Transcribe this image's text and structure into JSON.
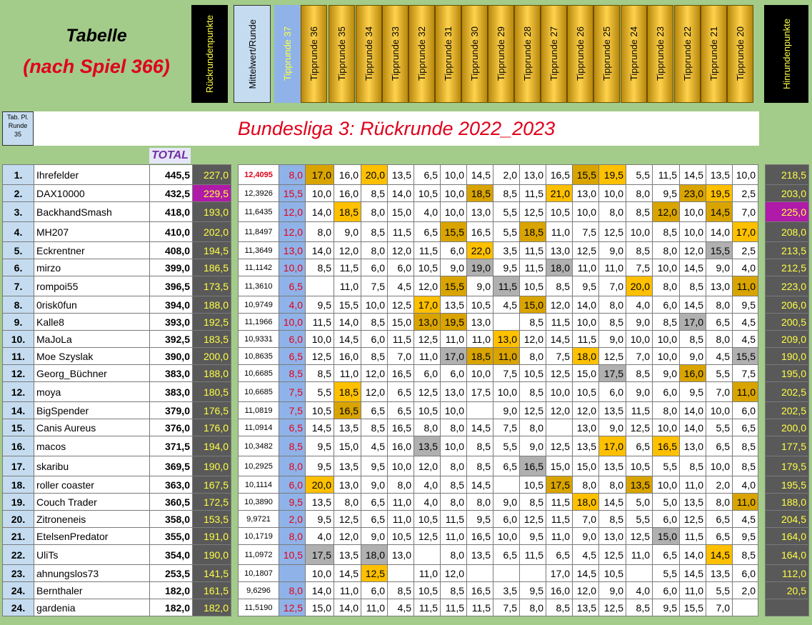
{
  "title_line1": "Tabelle",
  "title_line2": "(nach Spiel 366)",
  "headers": {
    "rueckrunde": "Rückrundenpunkte",
    "mittelwert": "Mittelwert/Runde",
    "tipp37": "Tipprunde 37",
    "tipprunden": [
      "Tipprunde 36",
      "Tipprunde 35",
      "Tipprunde 34",
      "Tipprunde 33",
      "Tipprunde 32",
      "Tipprunde 31",
      "Tipprunde 30",
      "Tipprunde 29",
      "Tipprunde 28",
      "Tipprunde 27",
      "Tipprunde 26",
      "Tipprunde 25",
      "Tipprunde 24",
      "Tipprunde 23",
      "Tipprunde 22",
      "Tipprunde 21",
      "Tipprunde 20"
    ],
    "hinrunde": "Hinrundenpunkte"
  },
  "tab_pl": [
    "Tab. Pl.",
    "Runde",
    "35"
  ],
  "banner": "Bundesliga 3: Rückrunde 2022_2023",
  "total_label": "TOTAL",
  "colors": {
    "background": "#a3cb8a",
    "gold": "#d9a400",
    "orange": "#ffc000",
    "silver": "#b0b0b0",
    "dark": "#595959",
    "yellow_text": "#ffff44",
    "red": "#e0001b",
    "magenta": "#b01aa8"
  },
  "rows": [
    {
      "pl": "1.",
      "name": "Ihrefelder",
      "total": "445,5",
      "rr": "227,0",
      "mw": "12,4095",
      "t37": "8,0",
      "t": [
        "17,0",
        "16,0",
        "20,0",
        "13,5",
        "6,5",
        "10,0",
        "14,5",
        "2,0",
        "13,0",
        "16,5",
        "15,5",
        "19,5",
        "5,5",
        "11,5",
        "14,5",
        "13,5",
        "10,0"
      ],
      "hr": "218,5",
      "mw_red": true
    },
    {
      "pl": "2.",
      "name": "DAX10000",
      "total": "432,5",
      "rr": "229,5",
      "mw": "12,3926",
      "t37": "15,5",
      "t": [
        "10,0",
        "16,0",
        "8,5",
        "14,0",
        "10,5",
        "10,0",
        "18,5",
        "8,5",
        "11,5",
        "21,0",
        "13,0",
        "10,0",
        "8,0",
        "9,5",
        "23,0",
        "19,5",
        "2,5"
      ],
      "hr": "203,0"
    },
    {
      "pl": "3.",
      "name": "BackhandSmash",
      "total": "418,0",
      "rr": "193,0",
      "mw": "11,6435",
      "t37": "12,0",
      "t": [
        "14,0",
        "18,5",
        "8,0",
        "15,0",
        "4,0",
        "10,0",
        "13,0",
        "5,5",
        "12,5",
        "10,5",
        "10,0",
        "8,0",
        "8,5",
        "12,0",
        "10,0",
        "14,5",
        "7,0"
      ],
      "hr": "225,0"
    },
    {
      "pl": "4.",
      "name": "MH207",
      "total": "410,0",
      "rr": "202,0",
      "mw": "11,8497",
      "t37": "12,0",
      "t": [
        "8,0",
        "9,0",
        "8,5",
        "11,5",
        "6,5",
        "15,5",
        "16,5",
        "5,5",
        "18,5",
        "11,0",
        "7,5",
        "12,5",
        "10,0",
        "8,5",
        "10,0",
        "14,0",
        "17,0"
      ],
      "hr": "208,0"
    },
    {
      "pl": "5.",
      "name": "Eckrentner",
      "total": "408,0",
      "rr": "194,5",
      "mw": "11,3649",
      "t37": "13,0",
      "t": [
        "14,0",
        "12,0",
        "8,0",
        "12,0",
        "11,5",
        "6,0",
        "22,0",
        "3,5",
        "11,5",
        "13,0",
        "12,5",
        "9,0",
        "8,5",
        "8,0",
        "12,0",
        "15,5",
        "2,5"
      ],
      "hr": "213,5"
    },
    {
      "pl": "6.",
      "name": "mirzo",
      "total": "399,0",
      "rr": "186,5",
      "mw": "11,1142",
      "t37": "10,0",
      "t": [
        "8,5",
        "11,5",
        "6,0",
        "6,0",
        "10,5",
        "9,0",
        "19,0",
        "9,5",
        "11,5",
        "18,0",
        "11,0",
        "11,0",
        "7,5",
        "10,0",
        "14,5",
        "9,0",
        "4,0"
      ],
      "hr": "212,5"
    },
    {
      "pl": "7.",
      "name": "rompoi55",
      "total": "396,5",
      "rr": "173,5",
      "mw": "11,3610",
      "t37": "6,5",
      "t": [
        "",
        "11,0",
        "7,5",
        "4,5",
        "12,0",
        "15,5",
        "9,0",
        "11,5",
        "10,5",
        "8,5",
        "9,5",
        "7,0",
        "20,0",
        "8,0",
        "8,5",
        "13,0",
        "11,0"
      ],
      "hr": "223,0"
    },
    {
      "pl": "8.",
      "name": "0risk0fun",
      "total": "394,0",
      "rr": "188,0",
      "mw": "10,9749",
      "t37": "4,0",
      "t": [
        "9,5",
        "15,5",
        "10,0",
        "12,5",
        "17,0",
        "13,5",
        "10,5",
        "4,5",
        "15,0",
        "12,0",
        "14,0",
        "8,0",
        "4,0",
        "6,0",
        "14,5",
        "8,0",
        "9,5"
      ],
      "hr": "206,0"
    },
    {
      "pl": "9.",
      "name": "Kalle8",
      "total": "393,0",
      "rr": "192,5",
      "mw": "11,1966",
      "t37": "10,0",
      "t": [
        "11,5",
        "14,0",
        "8,5",
        "15,0",
        "13,0",
        "19,5",
        "13,0",
        "",
        "8,5",
        "11,5",
        "10,0",
        "8,5",
        "9,0",
        "8,5",
        "17,0",
        "6,5",
        "4,5"
      ],
      "hr": "200,5"
    },
    {
      "pl": "10.",
      "name": "MaJoLa",
      "total": "392,5",
      "rr": "183,5",
      "mw": "10,9331",
      "t37": "6,0",
      "t": [
        "10,0",
        "14,5",
        "6,0",
        "11,5",
        "12,5",
        "11,0",
        "11,0",
        "13,0",
        "12,0",
        "14,5",
        "11,5",
        "9,0",
        "10,0",
        "10,0",
        "8,5",
        "8,0",
        "4,5"
      ],
      "hr": "209,0"
    },
    {
      "pl": "11.",
      "name": "Moe Szyslak",
      "total": "390,0",
      "rr": "200,0",
      "mw": "10,8635",
      "t37": "6,5",
      "t": [
        "12,5",
        "16,0",
        "8,5",
        "7,0",
        "11,0",
        "17,0",
        "18,5",
        "11,0",
        "8,0",
        "7,5",
        "18,0",
        "12,5",
        "7,0",
        "10,0",
        "9,0",
        "4,5",
        "15,5"
      ],
      "hr": "190,0"
    },
    {
      "pl": "12.",
      "name": "Georg_Büchner",
      "total": "383,0",
      "rr": "188,0",
      "mw": "10,6685",
      "t37": "8,5",
      "t": [
        "8,5",
        "11,0",
        "12,0",
        "16,5",
        "6,0",
        "6,0",
        "10,0",
        "7,5",
        "10,5",
        "12,5",
        "15,0",
        "17,5",
        "8,5",
        "9,0",
        "16,0",
        "5,5",
        "7,5"
      ],
      "hr": "195,0"
    },
    {
      "pl": "12.",
      "name": "moya",
      "total": "383,0",
      "rr": "180,5",
      "mw": "10,6685",
      "t37": "7,5",
      "t": [
        "5,5",
        "18,5",
        "12,0",
        "6,5",
        "12,5",
        "13,0",
        "17,5",
        "10,0",
        "8,5",
        "10,0",
        "10,5",
        "6,0",
        "9,0",
        "6,0",
        "9,5",
        "7,0",
        "11,0"
      ],
      "hr": "202,5"
    },
    {
      "pl": "14.",
      "name": "BigSpender",
      "total": "379,0",
      "rr": "176,5",
      "mw": "11,0819",
      "t37": "7,5",
      "t": [
        "10,5",
        "16,5",
        "6,5",
        "6,5",
        "10,5",
        "10,0",
        "",
        "9,0",
        "12,5",
        "12,0",
        "12,0",
        "13,5",
        "11,5",
        "8,0",
        "14,0",
        "10,0",
        "6,0"
      ],
      "hr": "202,5"
    },
    {
      "pl": "15.",
      "name": "Canis Aureus",
      "total": "376,0",
      "rr": "176,0",
      "mw": "11,0914",
      "t37": "6,5",
      "t": [
        "14,5",
        "13,5",
        "8,5",
        "16,5",
        "8,0",
        "8,0",
        "14,5",
        "7,5",
        "8,0",
        "",
        "13,0",
        "9,0",
        "12,5",
        "10,0",
        "14,0",
        "5,5",
        "6,5"
      ],
      "hr": "200,0"
    },
    {
      "pl": "16.",
      "name": "macos",
      "total": "371,5",
      "rr": "194,0",
      "mw": "10,3482",
      "t37": "8,5",
      "t": [
        "9,5",
        "15,0",
        "4,5",
        "16,0",
        "13,5",
        "10,0",
        "8,5",
        "5,5",
        "9,0",
        "12,5",
        "13,5",
        "17,0",
        "6,5",
        "16,5",
        "13,0",
        "6,5",
        "8,5"
      ],
      "hr": "177,5"
    },
    {
      "pl": "17.",
      "name": "skaribu",
      "total": "369,5",
      "rr": "190,0",
      "mw": "10,2925",
      "t37": "8,0",
      "t": [
        "9,5",
        "13,5",
        "9,5",
        "10,0",
        "12,0",
        "8,0",
        "8,5",
        "6,5",
        "16,5",
        "15,0",
        "15,0",
        "13,5",
        "10,5",
        "5,5",
        "8,5",
        "10,0",
        "8,5"
      ],
      "hr": "179,5"
    },
    {
      "pl": "18.",
      "name": "roller coaster",
      "total": "363,0",
      "rr": "167,5",
      "mw": "10,1114",
      "t37": "6,0",
      "t": [
        "20,0",
        "13,0",
        "9,0",
        "8,0",
        "4,0",
        "8,5",
        "14,5",
        "",
        "10,5",
        "17,5",
        "8,0",
        "8,0",
        "13,5",
        "10,0",
        "11,0",
        "2,0",
        "4,0"
      ],
      "hr": "195,5"
    },
    {
      "pl": "19.",
      "name": "Couch Trader",
      "total": "360,5",
      "rr": "172,5",
      "mw": "10,3890",
      "t37": "9,5",
      "t": [
        "13,5",
        "8,0",
        "6,5",
        "11,0",
        "4,0",
        "8,0",
        "8,0",
        "9,0",
        "8,5",
        "11,5",
        "18,0",
        "14,5",
        "5,0",
        "5,0",
        "13,5",
        "8,0",
        "11,0"
      ],
      "hr": "188,0"
    },
    {
      "pl": "20.",
      "name": "Zitroneneis",
      "total": "358,0",
      "rr": "153,5",
      "mw": "9,9721",
      "t37": "2,0",
      "t": [
        "9,5",
        "12,5",
        "6,5",
        "11,0",
        "10,5",
        "11,5",
        "9,5",
        "6,0",
        "12,5",
        "11,5",
        "7,0",
        "8,5",
        "5,5",
        "6,0",
        "12,5",
        "6,5",
        "4,5"
      ],
      "hr": "204,5"
    },
    {
      "pl": "21.",
      "name": "EtelsenPredator",
      "total": "355,0",
      "rr": "191,0",
      "mw": "10,1719",
      "t37": "8,0",
      "t": [
        "4,0",
        "12,0",
        "9,0",
        "10,5",
        "12,5",
        "11,0",
        "16,5",
        "10,0",
        "9,5",
        "11,0",
        "9,0",
        "13,0",
        "12,5",
        "15,0",
        "11,5",
        "6,5",
        "9,5"
      ],
      "hr": "164,0"
    },
    {
      "pl": "22.",
      "name": "UliTs",
      "total": "354,0",
      "rr": "190,0",
      "mw": "11,0972",
      "t37": "10,5",
      "t": [
        "17,5",
        "13,5",
        "18,0",
        "13,0",
        "",
        "8,0",
        "13,5",
        "6,5",
        "11,5",
        "6,5",
        "4,5",
        "12,5",
        "11,0",
        "6,5",
        "14,0",
        "14,5",
        "8,5"
      ],
      "hr": "164,0"
    },
    {
      "pl": "23.",
      "name": "ahnungslos73",
      "total": "253,5",
      "rr": "141,5",
      "mw": "10,1807",
      "t37": "",
      "t": [
        "10,0",
        "14,5",
        "12,5",
        "",
        "11,0",
        "12,0",
        "",
        "",
        "",
        "17,0",
        "14,5",
        "10,5",
        "",
        "5,5",
        "14,5",
        "13,5",
        "6,0"
      ],
      "hr": "112,0"
    },
    {
      "pl": "24.",
      "name": "Bernthaler",
      "total": "182,0",
      "rr": "161,5",
      "mw": "9,6296",
      "t37": "8,0",
      "t": [
        "14,0",
        "11,0",
        "6,0",
        "8,5",
        "10,5",
        "8,5",
        "16,5",
        "3,5",
        "9,5",
        "16,0",
        "12,0",
        "9,0",
        "4,0",
        "6,0",
        "11,0",
        "5,5",
        "2,0"
      ],
      "hr": "20,5"
    },
    {
      "pl": "24.",
      "name": "gardenia",
      "total": "182,0",
      "rr": "182,0",
      "mw": "11,5190",
      "t37": "12,5",
      "t": [
        "15,0",
        "14,0",
        "11,0",
        "4,5",
        "11,5",
        "11,5",
        "11,5",
        "7,5",
        "8,0",
        "8,5",
        "13,5",
        "12,5",
        "8,5",
        "9,5",
        "15,5",
        "7,0",
        ""
      ],
      "hr": ""
    }
  ]
}
